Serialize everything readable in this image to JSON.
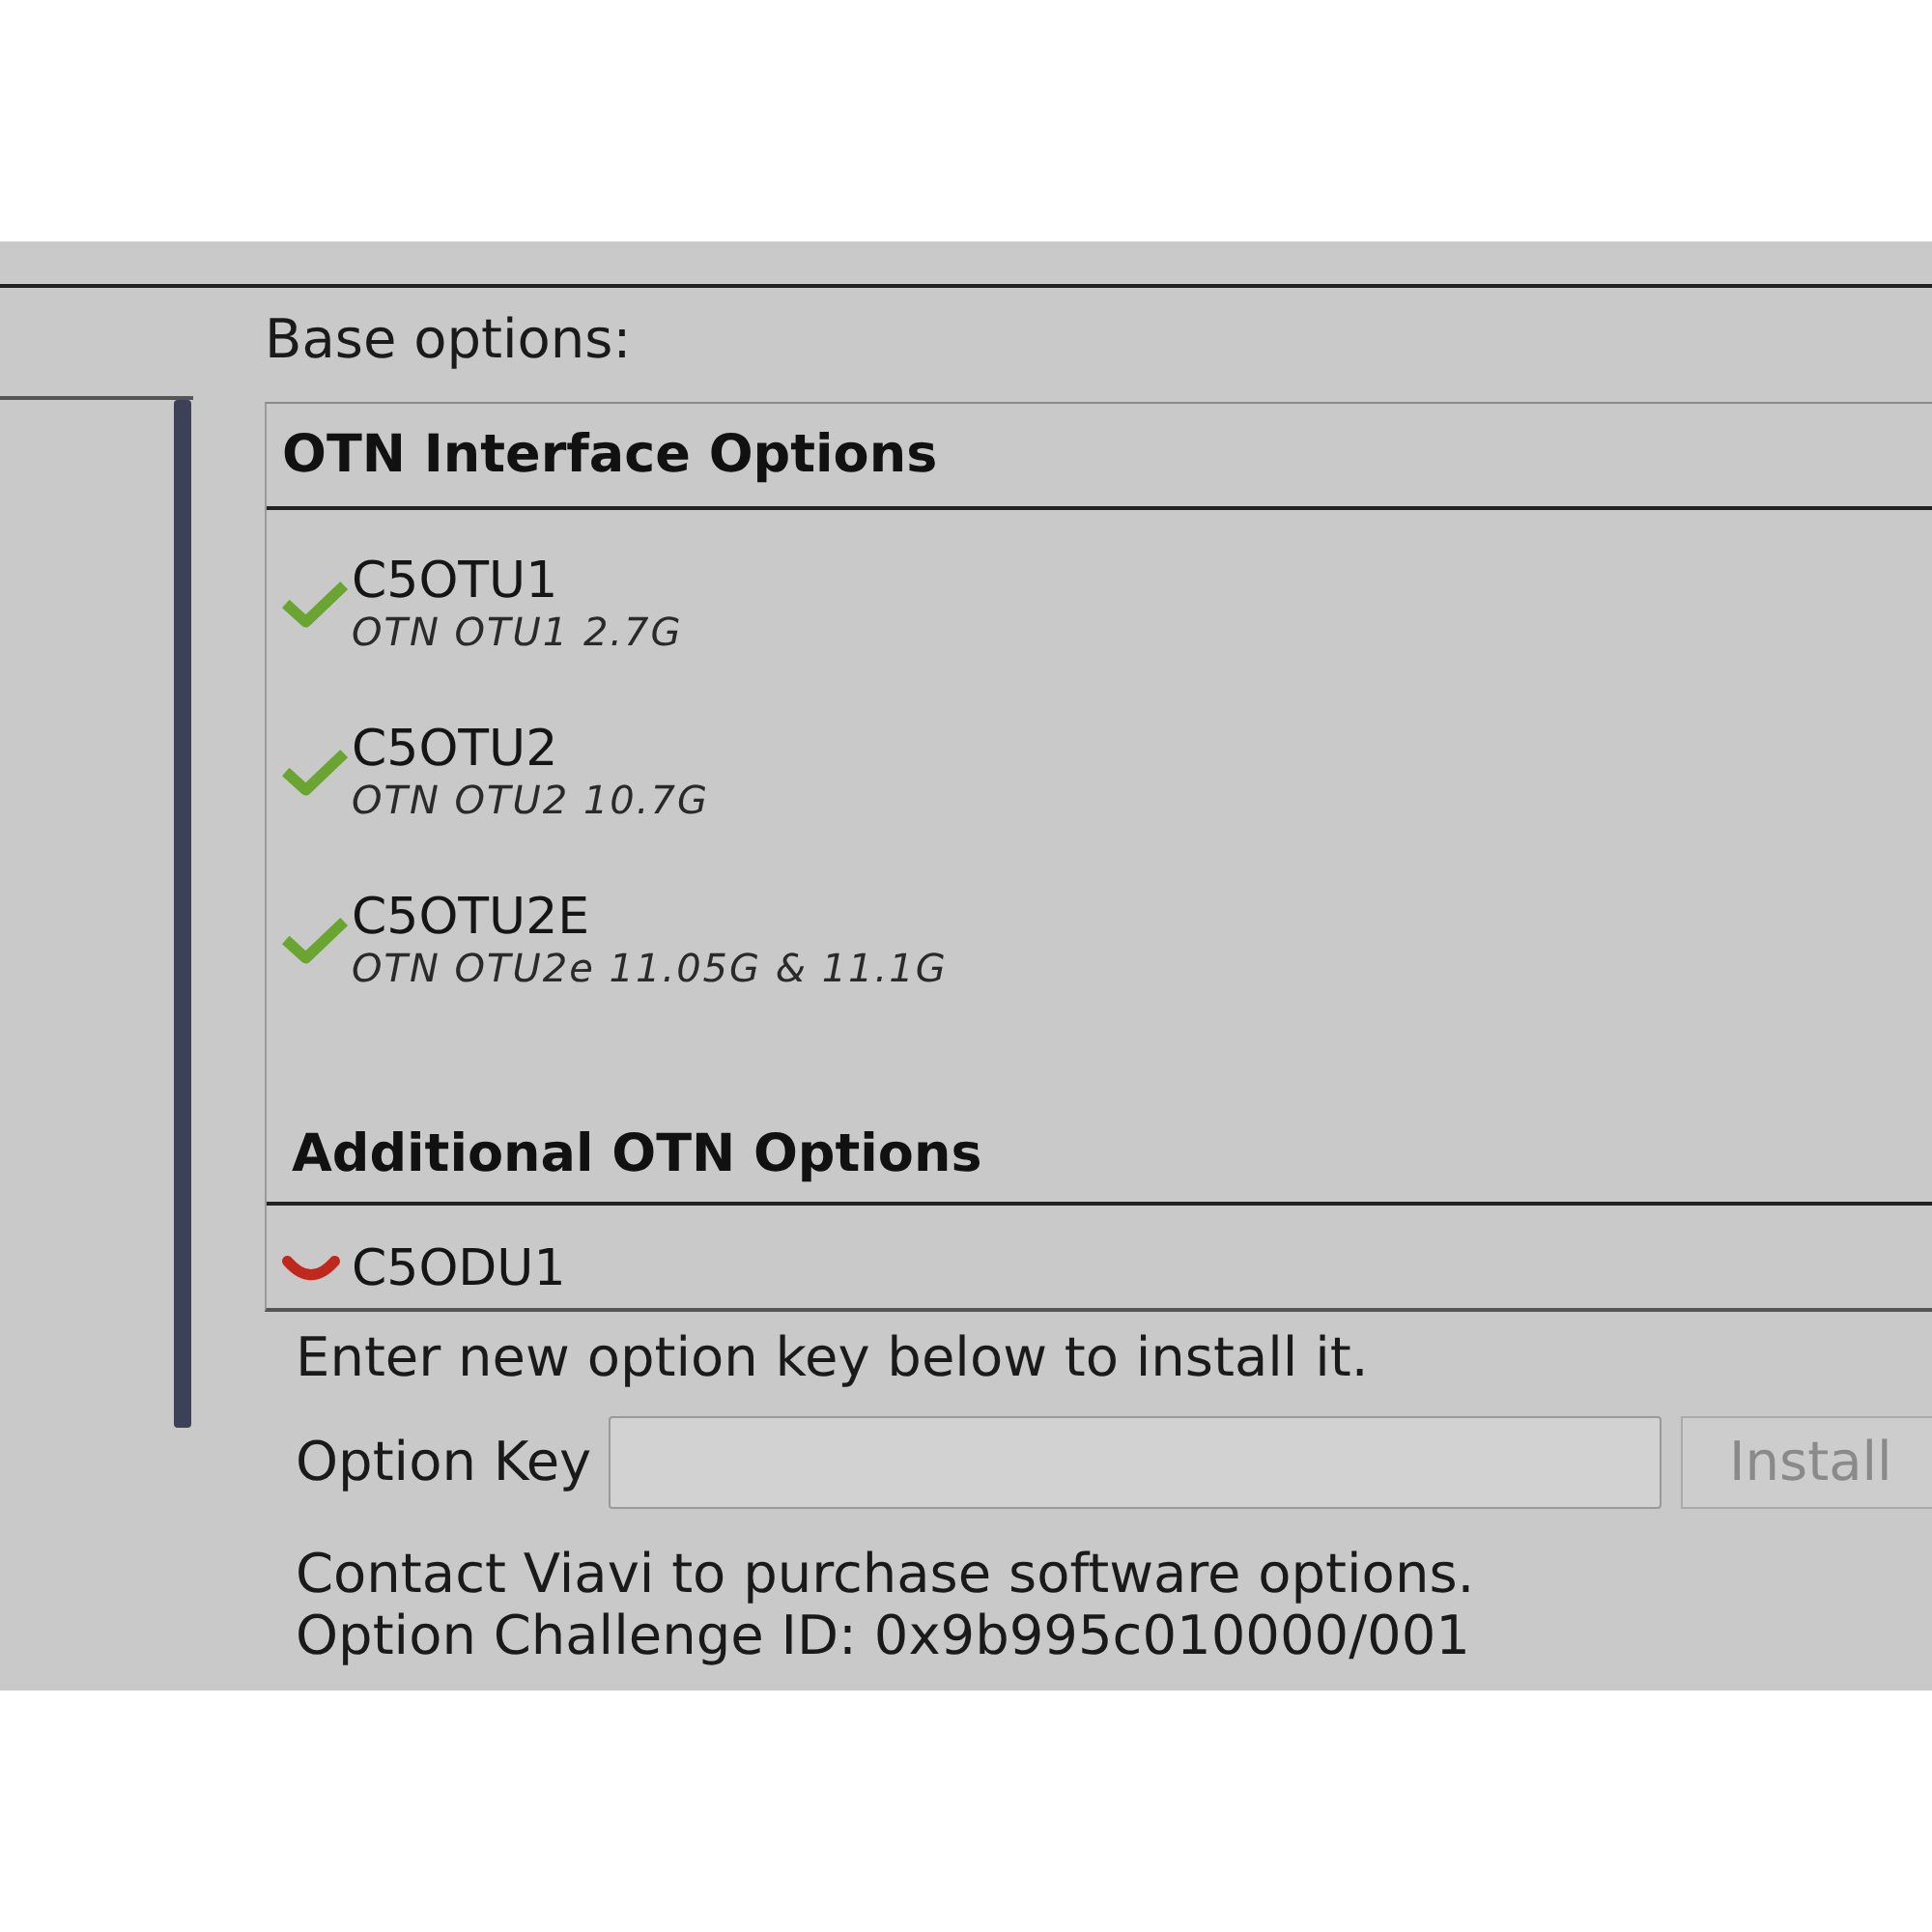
{
  "base_label": "Base options:",
  "option_groups": [
    {
      "title": "OTN Interface Options",
      "items": [
        {
          "name": "C5OTU1",
          "description": "OTN OTU1 2.7G",
          "installed": true
        },
        {
          "name": "C5OTU2",
          "description": "OTN OTU2 10.7G",
          "installed": true
        },
        {
          "name": "C5OTU2E",
          "description": "OTN OTU2e 11.05G & 11.1G",
          "installed": true
        }
      ]
    },
    {
      "title": "Additional OTN Options",
      "items": [
        {
          "name": "C5ODU1",
          "installed": false
        }
      ]
    }
  ],
  "install_prompt": "Enter new option key below to install it.",
  "option_key": {
    "label": "Option Key"
  },
  "install_button": {
    "label": "Install",
    "disabled": true
  },
  "footer_lines": [
    "Contact Viavi to purchase software options.",
    "Option Challenge ID: 0x9b995c010000/001"
  ]
}
